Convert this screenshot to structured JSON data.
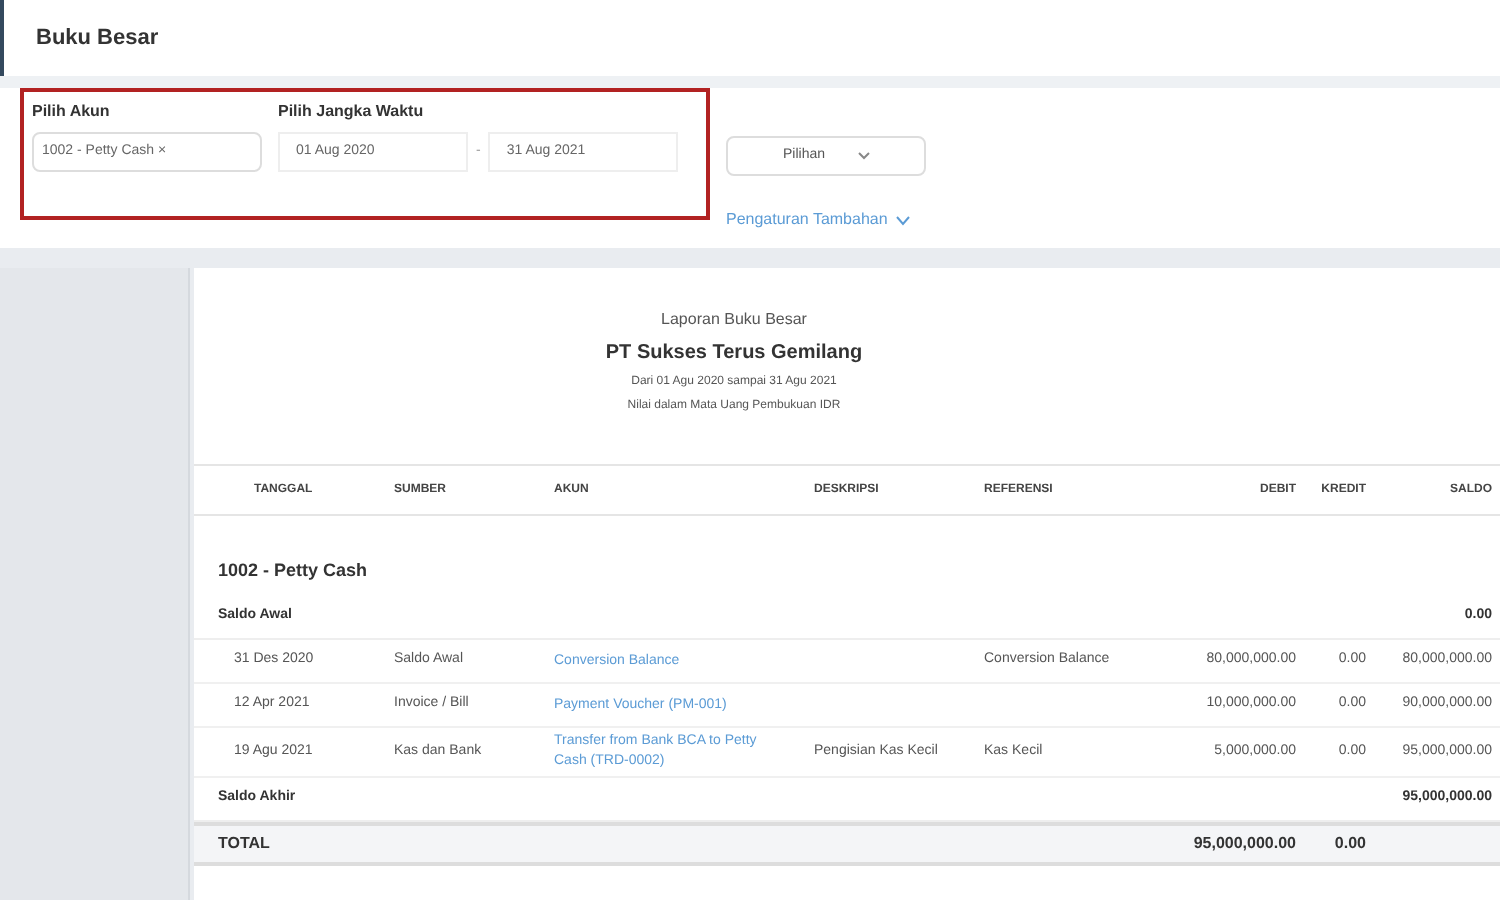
{
  "page_title": "Buku Besar",
  "filters": {
    "account_label": "Pilih Akun",
    "account_value": "1002 - Petty Cash ×",
    "period_label": "Pilih Jangka Waktu",
    "start_date": "01 Aug 2020",
    "separator": "-",
    "end_date": "31 Aug 2021",
    "options_button": "Pilihan",
    "advanced_link": "Pengaturan Tambahan"
  },
  "report": {
    "title": "Laporan Buku Besar",
    "company": "PT Sukses Terus Gemilang",
    "period": "Dari 01 Agu 2020 sampai 31 Agu 2021",
    "currency_note": "Nilai dalam Mata Uang Pembukuan IDR",
    "columns": [
      "TANGGAL",
      "SUMBER",
      "AKUN",
      "DESKRIPSI",
      "REFERENSI",
      "DEBIT",
      "KREDIT",
      "SALDO"
    ],
    "rows": [
      {
        "kind": "group",
        "label": "1002 - Petty Cash"
      },
      {
        "kind": "opening",
        "label": "Saldo Awal",
        "balance": "0.00"
      },
      {
        "kind": "entry",
        "date": "31 Des 2020",
        "source": "Saldo Awal",
        "account": "Conversion Balance",
        "reference": "Conversion Balance",
        "debit": "80,000,000.00",
        "credit": "0.00",
        "balance": "80,000,000.00"
      },
      {
        "kind": "entry",
        "date": "12 Apr 2021",
        "source": "Invoice / Bill",
        "account": "Payment Voucher (PM-001)",
        "debit": "10,000,000.00",
        "credit": "0.00",
        "balance": "90,000,000.00"
      },
      {
        "kind": "entry",
        "date": "19 Agu 2021",
        "source": "Kas dan Bank",
        "account": "Transfer from Bank BCA to Petty Cash (TRD-0002)",
        "description": "Pengisian Kas Kecil",
        "reference": "Kas Kecil",
        "debit": "5,000,000.00",
        "credit": "0.00",
        "balance": "95,000,000.00"
      },
      {
        "kind": "closing",
        "label": "Saldo Akhir",
        "balance": "95,000,000.00"
      },
      {
        "kind": "total",
        "label": "TOTAL",
        "debit": "95,000,000.00",
        "credit": "0.00"
      }
    ]
  }
}
